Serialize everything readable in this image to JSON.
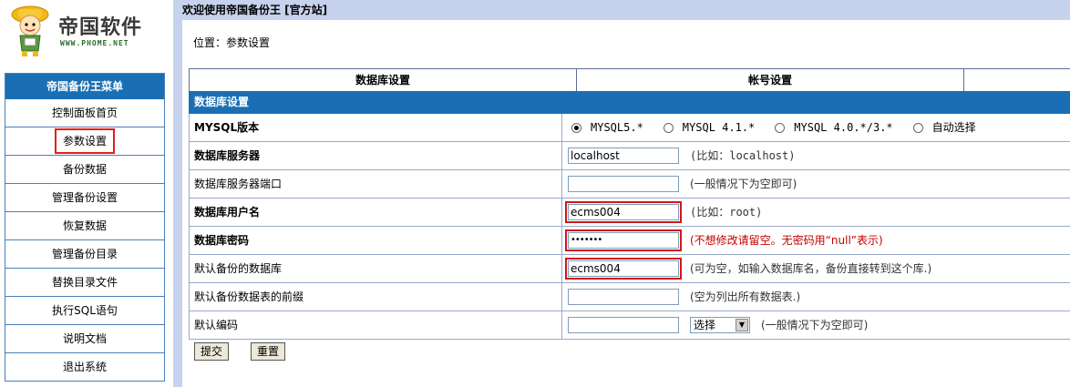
{
  "logo": {
    "brand": "帝国软件",
    "domain": "WWW.PHOME.NET"
  },
  "menu": {
    "title": "帝国备份王菜单",
    "items": [
      {
        "label": "控制面板首页"
      },
      {
        "label": "参数设置"
      },
      {
        "label": "备份数据"
      },
      {
        "label": "管理备份设置"
      },
      {
        "label": "恢复数据"
      },
      {
        "label": "管理备份目录"
      },
      {
        "label": "替换目录文件"
      },
      {
        "label": "执行SQL语句"
      },
      {
        "label": "说明文档"
      },
      {
        "label": "退出系统"
      }
    ]
  },
  "header": {
    "welcome": "欢迎使用帝国备份王 [官方站]",
    "breadcrumb": "位置：参数设置"
  },
  "tabs": [
    {
      "label": "数据库设置"
    },
    {
      "label": "帐号设置"
    },
    {
      "label": ""
    }
  ],
  "section_title": "数据库设置",
  "form": {
    "mysql_version": {
      "label": "MYSQL版本",
      "options": [
        "MYSQL5.*",
        "MYSQL 4.1.*",
        "MYSQL 4.0.*/3.*",
        "自动选择"
      ],
      "selected": "MYSQL5.*"
    },
    "db_server": {
      "label": "数据库服务器",
      "value": "localhost",
      "hint": "(比如：localhost)"
    },
    "db_port": {
      "label": "数据库服务器端口",
      "value": "",
      "hint": "(一般情况下为空即可)"
    },
    "db_user": {
      "label": "数据库用户名",
      "value": "ecms004",
      "hint": "(比如：root)"
    },
    "db_password": {
      "label": "数据库密码",
      "value": "•••••••",
      "hint": "(不想修改请留空。无密码用“null”表示)"
    },
    "default_db": {
      "label": "默认备份的数据库",
      "value": "ecms004",
      "hint": "(可为空，如输入数据库名，备份直接转到这个库.)"
    },
    "table_prefix": {
      "label": "默认备份数据表的前缀",
      "value": "",
      "hint": "(空为列出所有数据表.)"
    },
    "charset": {
      "label": "默认编码",
      "value": "",
      "select": "选择",
      "hint": "(一般情况下为空即可)"
    }
  },
  "buttons": {
    "submit": "提交",
    "reset": "重置"
  },
  "colors": {
    "menu_title_bg": "#1a6fb4",
    "topbar_bg": "#c6d2ee",
    "highlight": "#e02020"
  }
}
